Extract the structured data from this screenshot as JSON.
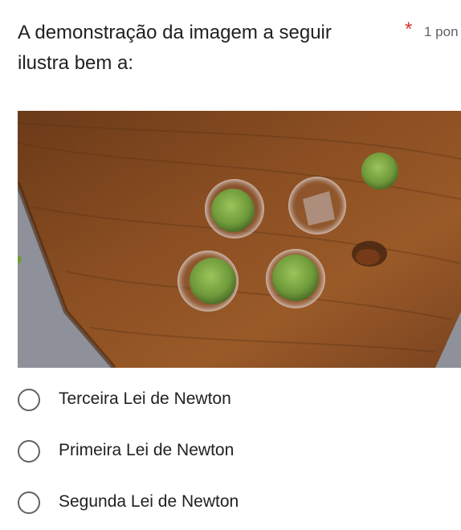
{
  "question": {
    "title": "A demonstração da imagem a seguir ilustra bem a:",
    "required_marker": "*",
    "points": "1 pon"
  },
  "image": {
    "content": "photo-of-tennis-balls-in-glasses-on-wooden-table"
  },
  "options": [
    {
      "label": "Terceira Lei de Newton",
      "selected": false
    },
    {
      "label": "Primeira Lei de Newton",
      "selected": false
    },
    {
      "label": "Segunda Lei de Newton",
      "selected": false
    }
  ],
  "colors": {
    "required": "#d93025",
    "text": "#202124",
    "secondary_text": "#5f6368",
    "radio_border": "#5f6368"
  }
}
